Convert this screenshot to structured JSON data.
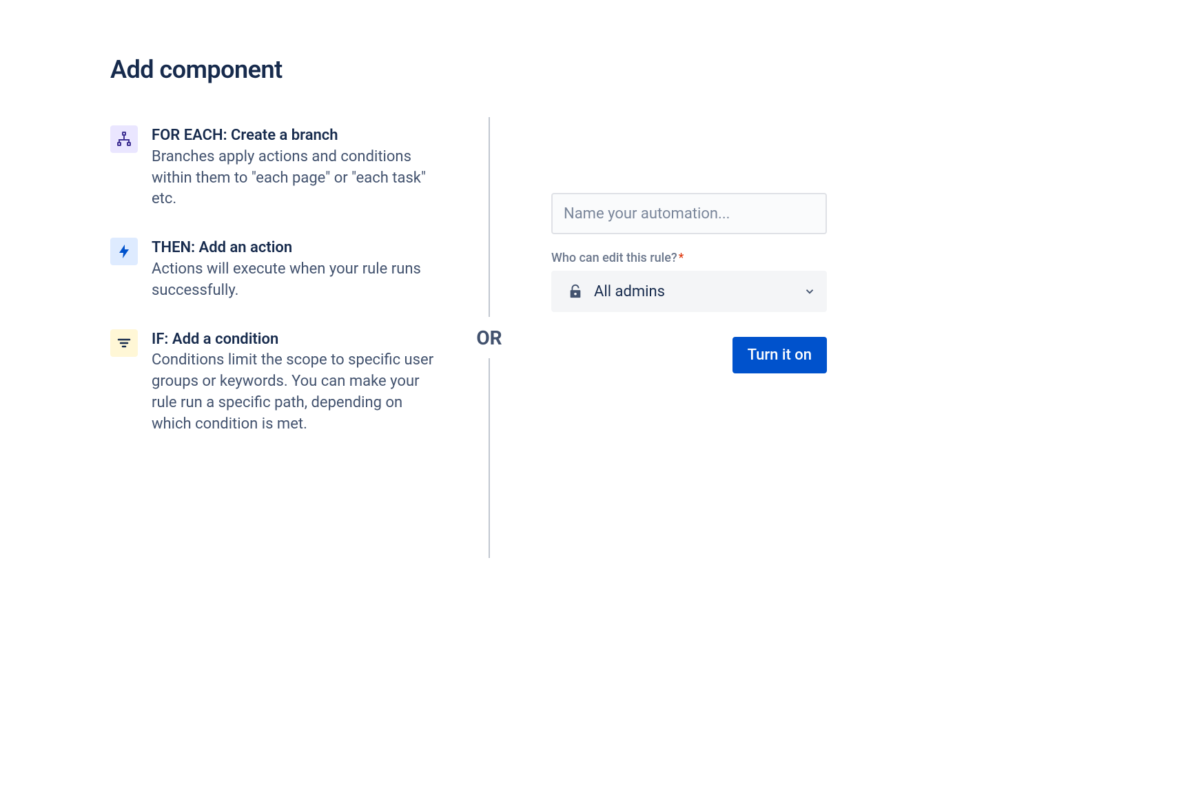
{
  "page": {
    "title": "Add component"
  },
  "components": [
    {
      "icon": "branch-icon",
      "title": "FOR EACH: Create a branch",
      "desc": "Branches apply actions and conditions within them to \"each page\" or \"each task\" etc."
    },
    {
      "icon": "lightning-icon",
      "title": "THEN: Add an action",
      "desc": "Actions will execute when your rule runs successfully."
    },
    {
      "icon": "filter-icon",
      "title": "IF: Add a condition",
      "desc": "Conditions limit the scope to specific user groups or keywords. You can make your rule run a specific path, depending on which condition is met."
    }
  ],
  "divider": {
    "label": "OR"
  },
  "form": {
    "name_placeholder": "Name your automation...",
    "edit_label": "Who can edit this rule?",
    "edit_value": "All admins",
    "submit_label": "Turn it on"
  }
}
